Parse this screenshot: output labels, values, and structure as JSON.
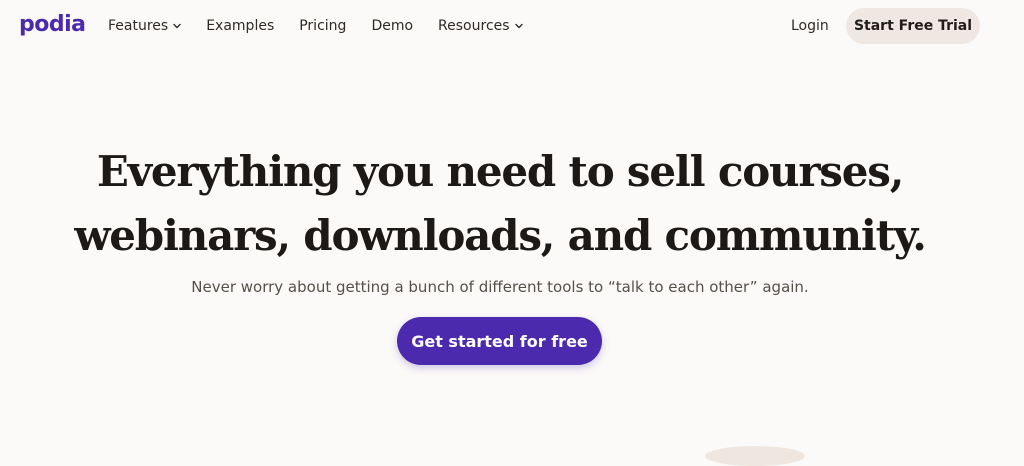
{
  "brand": {
    "logo_text": "podia",
    "color": "#4b2aad"
  },
  "nav": {
    "items": [
      {
        "label": "Features",
        "has_dropdown": true,
        "icon": "chevron-down-icon"
      },
      {
        "label": "Examples",
        "has_dropdown": false
      },
      {
        "label": "Pricing",
        "has_dropdown": false
      },
      {
        "label": "Demo",
        "has_dropdown": false
      },
      {
        "label": "Resources",
        "has_dropdown": true,
        "icon": "chevron-down-icon"
      }
    ],
    "login_label": "Login",
    "trial_label": "Start Free Trial",
    "trial_bg": "#efe8e2"
  },
  "hero": {
    "headline_line1": "Everything you need to sell courses,",
    "headline_line2": "webinars, downloads, and community.",
    "subheadline": "Never worry about getting a bunch of different tools to “talk to each other” again.",
    "cta_label": "Get started for free",
    "cta_color": "#4b2aad"
  },
  "colors": {
    "background": "#fcfaf8",
    "text": "#1c1916",
    "muted_text": "#55504a"
  }
}
